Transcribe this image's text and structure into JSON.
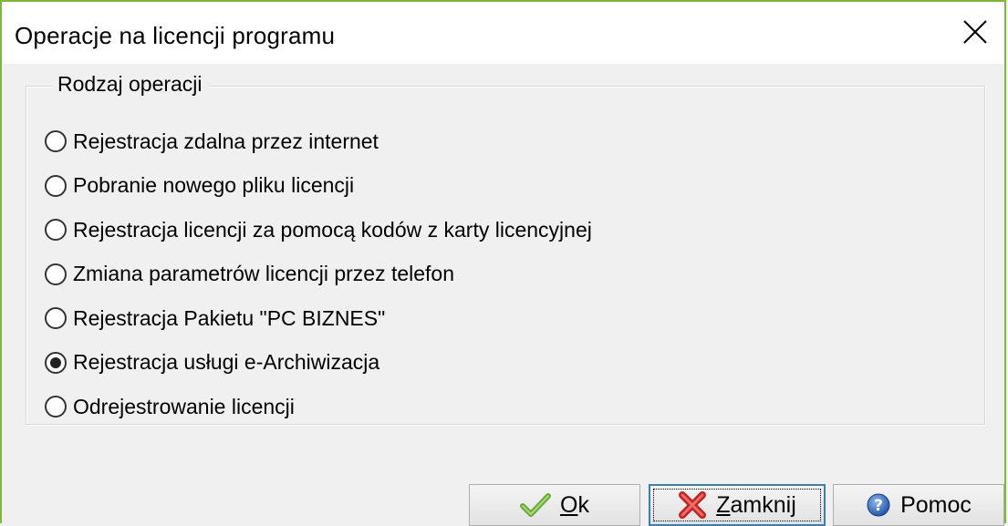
{
  "window": {
    "title": "Operacje na licencji programu",
    "border_color": "#7db73c"
  },
  "group": {
    "legend": "Rodzaj operacji",
    "options": [
      {
        "label": "Rejestracja zdalna przez internet",
        "selected": false
      },
      {
        "label": "Pobranie nowego pliku licencji",
        "selected": false
      },
      {
        "label": "Rejestracja licencji za pomocą kodów z karty licencyjnej",
        "selected": false
      },
      {
        "label": "Zmiana parametrów licencji przez telefon",
        "selected": false
      },
      {
        "label": "Rejestracja Pakietu \"PC BIZNES\"",
        "selected": false
      },
      {
        "label": "Rejestracja usługi e-Archiwizacja",
        "selected": true
      },
      {
        "label": "Odrejestrowanie licencji",
        "selected": false
      }
    ]
  },
  "buttons": {
    "ok": {
      "mnemonic": "O",
      "rest": "k",
      "icon": "checkmark-icon"
    },
    "close": {
      "mnemonic": "Z",
      "rest": "amknij",
      "icon": "red-x-icon"
    },
    "help": {
      "label": "Pomoc",
      "icon": "help-icon"
    }
  }
}
